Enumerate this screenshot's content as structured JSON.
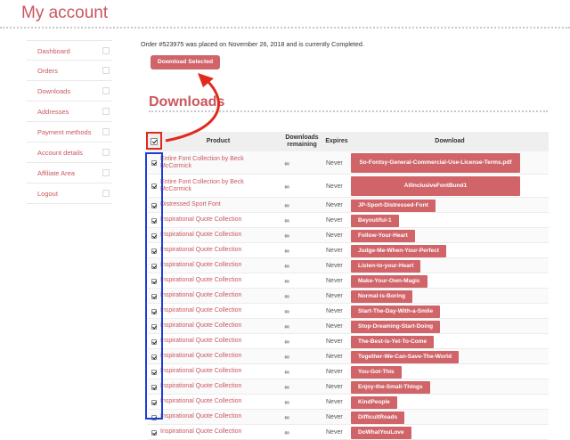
{
  "page": {
    "title": "My account"
  },
  "sidebar": {
    "items": [
      {
        "label": "Dashboard",
        "icon": "dashboard-icon"
      },
      {
        "label": "Orders",
        "icon": "basket-icon"
      },
      {
        "label": "Downloads",
        "icon": "file-download-icon"
      },
      {
        "label": "Addresses",
        "icon": "home-icon"
      },
      {
        "label": "Payment methods",
        "icon": "credit-card-icon"
      },
      {
        "label": "Account details",
        "icon": "user-icon"
      },
      {
        "label": "Affiliate Area",
        "icon": "affiliate-icon"
      },
      {
        "label": "Logout",
        "icon": "logout-icon"
      }
    ]
  },
  "main": {
    "order_line": "Order #523975 was placed on November 26, 2018 and is currently Completed.",
    "download_selected_label": "Download Selected",
    "section_title": "Downloads"
  },
  "table": {
    "headers": {
      "product": "Product",
      "remaining": "Downloads remaining",
      "expires": "Expires",
      "download": "Download"
    },
    "rows": [
      {
        "product": "Entire Font Collection by Beck McCormick",
        "remaining": "∞",
        "expires": "Never",
        "download": "So-Fontsy-General-Commercial-Use-License-Terms.pdf"
      },
      {
        "product": "Entire Font Collection by Beck McCormick",
        "remaining": "∞",
        "expires": "Never",
        "download": "AllInclusiveFontBund1"
      },
      {
        "product": "Distressed Sport Font",
        "remaining": "∞",
        "expires": "Never",
        "download": "JP-Sport-Distressed-Font"
      },
      {
        "product": "Inspirational Quote Collection",
        "remaining": "∞",
        "expires": "Never",
        "download": "Beyoutiful-1"
      },
      {
        "product": "Inspirational Quote Collection",
        "remaining": "∞",
        "expires": "Never",
        "download": "Follow-Your-Heart"
      },
      {
        "product": "Inspirational Quote Collection",
        "remaining": "∞",
        "expires": "Never",
        "download": "Judge-Me-When-Your-Perfect"
      },
      {
        "product": "Inspirational Quote Collection",
        "remaining": "∞",
        "expires": "Never",
        "download": "Listen-to-your-Heart"
      },
      {
        "product": "Inspirational Quote Collection",
        "remaining": "∞",
        "expires": "Never",
        "download": "Make-Your-Own-Magic"
      },
      {
        "product": "Inspirational Quote Collection",
        "remaining": "∞",
        "expires": "Never",
        "download": "Normal-is-Boring"
      },
      {
        "product": "Inspirational Quote Collection",
        "remaining": "∞",
        "expires": "Never",
        "download": "Start-The-Day-With-a-Smile"
      },
      {
        "product": "Inspirational Quote Collection",
        "remaining": "∞",
        "expires": "Never",
        "download": "Stop-Dreaming-Start-Doing"
      },
      {
        "product": "Inspirational Quote Collection",
        "remaining": "∞",
        "expires": "Never",
        "download": "The-Best-is-Yet-To-Come"
      },
      {
        "product": "Inspirational Quote Collection",
        "remaining": "∞",
        "expires": "Never",
        "download": "Together-We-Can-Save-The-World"
      },
      {
        "product": "Inspirational Quote Collection",
        "remaining": "∞",
        "expires": "Never",
        "download": "You-Got-This"
      },
      {
        "product": "Inspirational Quote Collection",
        "remaining": "∞",
        "expires": "Never",
        "download": "Enjoy-the-Small-Things"
      },
      {
        "product": "Inspirational Quote Collection",
        "remaining": "∞",
        "expires": "Never",
        "download": "KindPeople"
      },
      {
        "product": "Inspirational Quote Collection",
        "remaining": "∞",
        "expires": "Never",
        "download": "DifficultRoads"
      },
      {
        "product": "Inspirational Quote Collection",
        "remaining": "∞",
        "expires": "Never",
        "download": "DoWhatYouLove"
      }
    ]
  },
  "colors": {
    "accent": "#c9575e",
    "button": "#d06469",
    "annotation_red": "#e02a1e",
    "annotation_blue": "#1a3fd8"
  }
}
